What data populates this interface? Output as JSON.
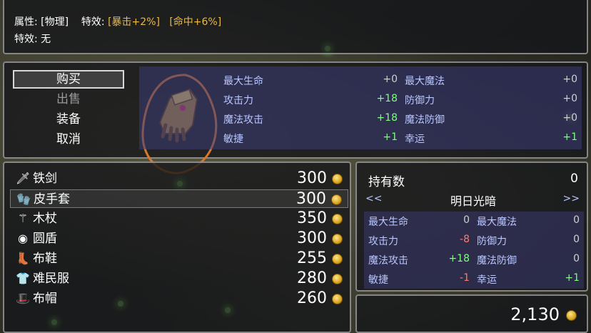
{
  "info": {
    "attr_label": "属性:",
    "attr_value": "[物理]",
    "effect_label": "特效:",
    "effect_1": "[暴击+2%]",
    "effect_2": "[命中+6%]",
    "effect2_label": "特效:",
    "effect2_value": "无"
  },
  "menu": [
    {
      "label": "购买",
      "state": "selected"
    },
    {
      "label": "出售",
      "state": "disabled"
    },
    {
      "label": "装备",
      "state": "normal"
    },
    {
      "label": "取消",
      "state": "normal"
    }
  ],
  "selected_item_icon": "leather-glove-icon",
  "stats_preview": [
    {
      "name": "最大生命",
      "value": "+0",
      "tone": "zero"
    },
    {
      "name": "最大魔法",
      "value": "+0",
      "tone": "zero"
    },
    {
      "name": "攻击力",
      "value": "+18",
      "tone": "pos"
    },
    {
      "name": "防御力",
      "value": "+0",
      "tone": "zero"
    },
    {
      "name": "魔法攻击",
      "value": "+18",
      "tone": "pos"
    },
    {
      "name": "魔法防御",
      "value": "+0",
      "tone": "zero"
    },
    {
      "name": "敏捷",
      "value": "+1",
      "tone": "pos"
    },
    {
      "name": "幸运",
      "value": "+1",
      "tone": "pos"
    }
  ],
  "items": [
    {
      "name": "铁剑",
      "price": "300",
      "icon": "sword-icon",
      "glyph": "🗡"
    },
    {
      "name": "皮手套",
      "price": "300",
      "icon": "glove-icon",
      "glyph": "🧤"
    },
    {
      "name": "木杖",
      "price": "350",
      "icon": "staff-icon",
      "glyph": "⚚"
    },
    {
      "name": "圆盾",
      "price": "300",
      "icon": "shield-icon",
      "glyph": "◉"
    },
    {
      "name": "布鞋",
      "price": "255",
      "icon": "boots-icon",
      "glyph": "👢"
    },
    {
      "name": "难民服",
      "price": "280",
      "icon": "clothes-icon",
      "glyph": "👕"
    },
    {
      "name": "布帽",
      "price": "260",
      "icon": "hat-icon",
      "glyph": "🎩"
    }
  ],
  "selected_index": 1,
  "detail": {
    "owned_label": "持有数",
    "owned_value": "0",
    "prev": "<<",
    "next": ">>",
    "character": "明日光暗",
    "stats": [
      {
        "name": "最大生命",
        "value": "0",
        "tone": "zero"
      },
      {
        "name": "最大魔法",
        "value": "0",
        "tone": "zero"
      },
      {
        "name": "攻击力",
        "value": "-8",
        "tone": "neg"
      },
      {
        "name": "防御力",
        "value": "0",
        "tone": "zero"
      },
      {
        "name": "魔法攻击",
        "value": "+18",
        "tone": "pos"
      },
      {
        "name": "魔法防御",
        "value": "0",
        "tone": "zero"
      },
      {
        "name": "敏捷",
        "value": "-1",
        "tone": "neg"
      },
      {
        "name": "幸运",
        "value": "+1",
        "tone": "pos"
      }
    ]
  },
  "gold": "2,130",
  "colors": {
    "gold_text": "#e8b84a",
    "stat_label": "#b9c6ff",
    "positive": "#7dff7d",
    "negative": "#ff7a6a",
    "annotation": "#d9782a"
  }
}
